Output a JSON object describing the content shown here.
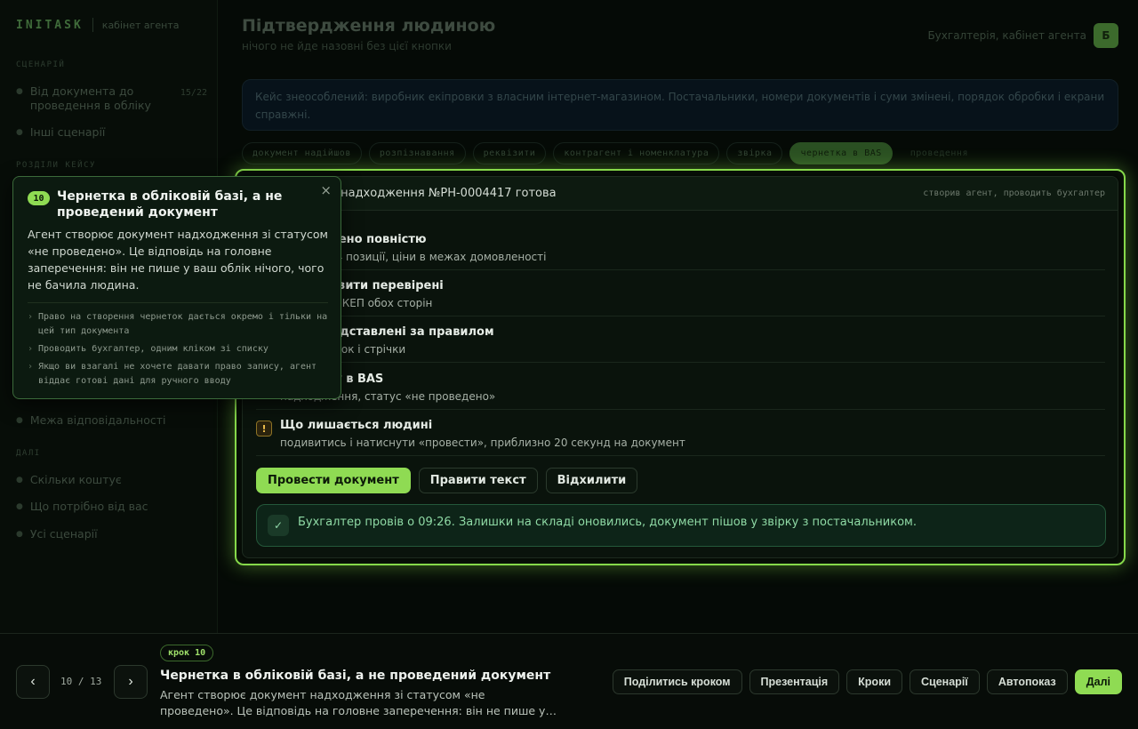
{
  "brand": {
    "logo": "INITASK",
    "subtitle": "кабінет агента"
  },
  "sidebar": {
    "section_scenario": "СЦЕНАРІЙ",
    "scenario_items": [
      {
        "label": "Від документа до проведення в обліку",
        "count": "15/22"
      },
      {
        "label": "Інші сценарії"
      }
    ],
    "section_chapter": "РОЗДІЛИ КЕЙСУ",
    "chapter_items": [
      {
        "label": "Межа відповідальності"
      }
    ],
    "section_next": "ДАЛІ",
    "next_items": [
      {
        "label": "Скільки коштує"
      },
      {
        "label": "Що потрібно від вас"
      },
      {
        "label": "Усі сценарії"
      }
    ]
  },
  "header": {
    "title": "Підтвердження людиною",
    "subtitle": "нічого не йде назовні без цієї кнопки",
    "user_label": "Бухгалтерія, кабінет агента",
    "avatar": "Б"
  },
  "case_note": "Кейс знеособлений: виробник екіпровки з власним інтернет-магазином. Постачальники, номери документів і суми змінені, порядок обробки і екрани справжні.",
  "steps": [
    "документ надійшов",
    "розпізнавання",
    "реквізити",
    "контрагент і номенклатура",
    "звірка",
    "чернетка в BAS",
    "проведення"
  ],
  "card": {
    "title": "а надходження №РН-0004417 готова",
    "meta": "створив агент, проводить бухгалтер",
    "checks": [
      {
        "title": "т зіставлено повністю",
        "desc": ", договір, 4 позиції, ціни в межах домовленості"
      },
      {
        "title": "ові реквізити перевірені",
        "desc": "підписами КЕП обох сторін"
      },
      {
        "title": "обліку підставлені за правилом",
        "desc": "анини, ниток і стрічки"
      },
      {
        "title": "чернетку в BAS",
        "desc": "надходження, статус «не проведено»"
      },
      {
        "title": "Що лишається людині",
        "desc": "подивитись і натиснути «провести», приблизно 20 секунд на документ",
        "icon": "!"
      }
    ],
    "actions": {
      "post": "Провести документ",
      "edit": "Правити текст",
      "reject": "Відхилити"
    },
    "success": {
      "icon": "✓",
      "text": "Бухгалтер провів о 09:26. Залишки на складі оновились, документ пішов у звірку з постачальником."
    }
  },
  "popover": {
    "badge": "10",
    "title": "Чернетка в обліковій базі, а не проведений документ",
    "close": "×",
    "text": "Агент створює документ надходження зі статусом «не проведено». Це відповідь на головне заперечення: він не пише у ваш облік нічого, чого не бачила людина.",
    "bullets": [
      "Право на створення чернеток дається окремо і тільки на цей тип документа",
      "Проводить бухгалтер, одним кліком зі списку",
      "Якщо ви взагалі не хочете давати право запису, агент віддає готові дані для ручного вводу"
    ]
  },
  "bottom": {
    "prev": "‹",
    "next": "›",
    "counter": "10 / 13",
    "step_badge": "крок 10",
    "title": "Чернетка в обліковій базі, а не проведений документ",
    "desc": "Агент створює документ надходження зі статусом «не проведено». Це відповідь на головне заперечення: він не пише у…",
    "buttons": {
      "share": "Поділитись кроком",
      "presentation": "Презентація",
      "steps": "Кроки",
      "scenarios": "Сценарії",
      "autoplay": "Автопоказ",
      "next": "Далі"
    }
  },
  "colors": {
    "accent": "#8fdb53",
    "success": "#8fdaa5",
    "warning": "#f2c14e",
    "background": "#050a06"
  }
}
